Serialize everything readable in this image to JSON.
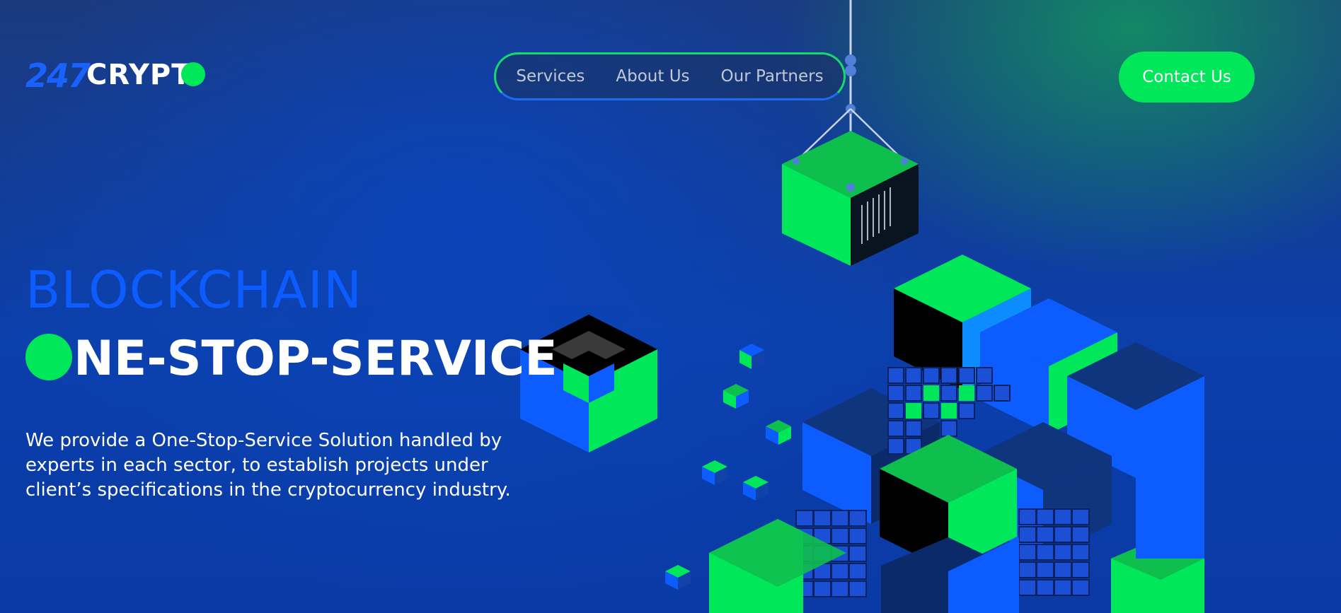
{
  "logo": {
    "number": "247",
    "word": "CRYPT"
  },
  "nav": {
    "items": [
      "Services",
      "About Us",
      "Our Partners"
    ]
  },
  "header": {
    "contact_label": "Contact Us"
  },
  "hero": {
    "title_line1": "BLOCKCHAIN",
    "title_line2_rest": "NE-STOP-SERVICE",
    "description": "We provide a One-Stop-Service Solution handled by experts in each sector, to establish projects under client’s specifications in the cryptocurrency industry."
  },
  "colors": {
    "accent_green": "#00e85a",
    "accent_blue": "#0d5cff",
    "bg_navy": "#0b3fab"
  }
}
